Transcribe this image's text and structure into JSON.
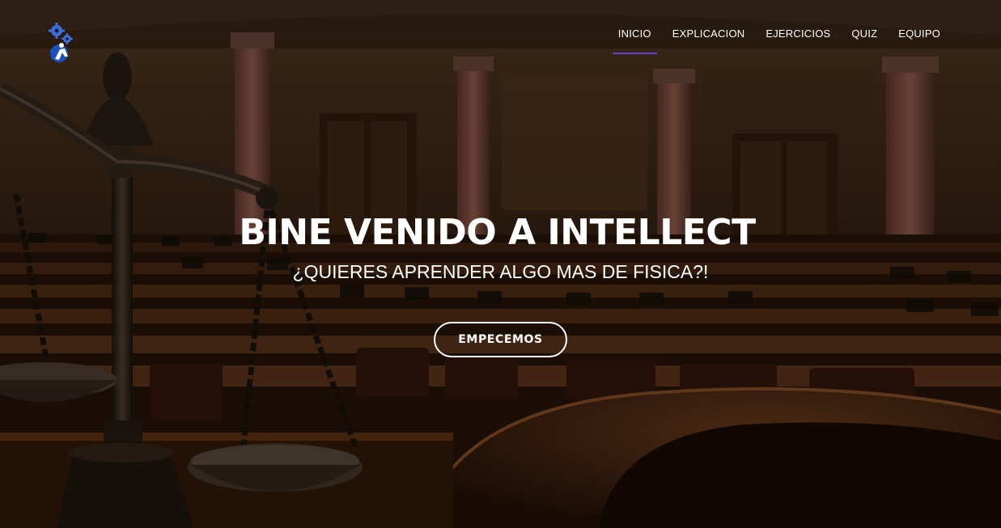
{
  "header": {
    "logo_icon": "gear-person-logo-icon",
    "nav": [
      {
        "label": "INICIO",
        "active": true
      },
      {
        "label": "EXPLICACION",
        "active": false
      },
      {
        "label": "EJERCICIOS",
        "active": false
      },
      {
        "label": "QUIZ",
        "active": false
      },
      {
        "label": "EQUIPO",
        "active": false
      }
    ],
    "active_underline_color": "#6a3ccf"
  },
  "hero": {
    "title": "BINE VENIDO A INTELLECT",
    "subtitle": "¿QUIERES APRENDER ALGO MAS DE FISICA?!",
    "cta_label": "EMPECEMOS",
    "background_image": "courtroom-with-scales-of-justice"
  }
}
